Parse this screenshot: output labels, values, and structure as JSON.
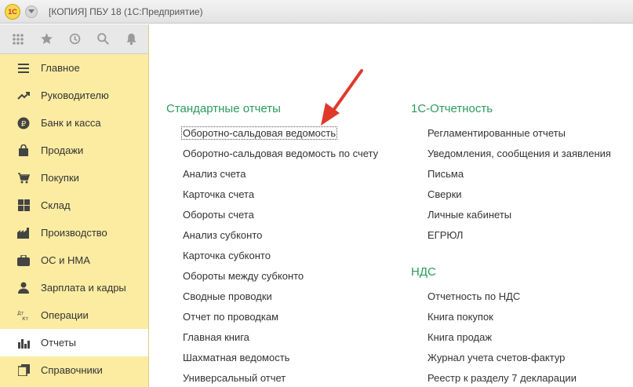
{
  "window": {
    "title": "[КОПИЯ] ПБУ 18  (1С:Предприятие)",
    "logo_text": "1С"
  },
  "toolbar": {
    "icons": [
      "apps-grid-icon",
      "star-icon",
      "history-icon",
      "search-icon",
      "bell-icon"
    ]
  },
  "sidebar": {
    "items": [
      {
        "label": "Главное",
        "icon": "menu-lines-icon"
      },
      {
        "label": "Руководителю",
        "icon": "trend-up-icon"
      },
      {
        "label": "Банк и касса",
        "icon": "ruble-coin-icon"
      },
      {
        "label": "Продажи",
        "icon": "shopping-bag-icon"
      },
      {
        "label": "Покупки",
        "icon": "basket-icon"
      },
      {
        "label": "Склад",
        "icon": "warehouse-grid-icon"
      },
      {
        "label": "Производство",
        "icon": "factory-icon"
      },
      {
        "label": "ОС и НМА",
        "icon": "assets-icon"
      },
      {
        "label": "Зарплата и кадры",
        "icon": "people-icon"
      },
      {
        "label": "Операции",
        "icon": "debit-credit-icon",
        "icon_text": "Дт Кт"
      },
      {
        "label": "Отчеты",
        "icon": "bar-chart-icon",
        "active": true
      },
      {
        "label": "Справочники",
        "icon": "books-icon"
      }
    ]
  },
  "main": {
    "standard": {
      "title": "Стандартные отчеты",
      "items": [
        "Оборотно-сальдовая ведомость",
        "Оборотно-сальдовая ведомость по счету",
        "Анализ счета",
        "Карточка счета",
        "Обороты счета",
        "Анализ субконто",
        "Карточка субконто",
        "Обороты между субконто",
        "Сводные проводки",
        "Отчет по проводкам",
        "Главная книга",
        "Шахматная ведомость",
        "Универсальный отчет"
      ]
    },
    "reporting": {
      "title": "1С-Отчетность",
      "items": [
        "Регламентированные отчеты",
        "Уведомления, сообщения и заявления",
        "Письма",
        "Сверки",
        "Личные кабинеты",
        "ЕГРЮЛ"
      ]
    },
    "vat": {
      "title": "НДС",
      "items": [
        "Отчетность по НДС",
        "Книга покупок",
        "Книга продаж",
        "Журнал учета счетов-фактур",
        "Реестр к разделу 7 декларации"
      ]
    }
  },
  "colors": {
    "sidebar_bg": "#fbeca1",
    "section_title": "#2d9a5c",
    "arrow": "#e0392b"
  }
}
